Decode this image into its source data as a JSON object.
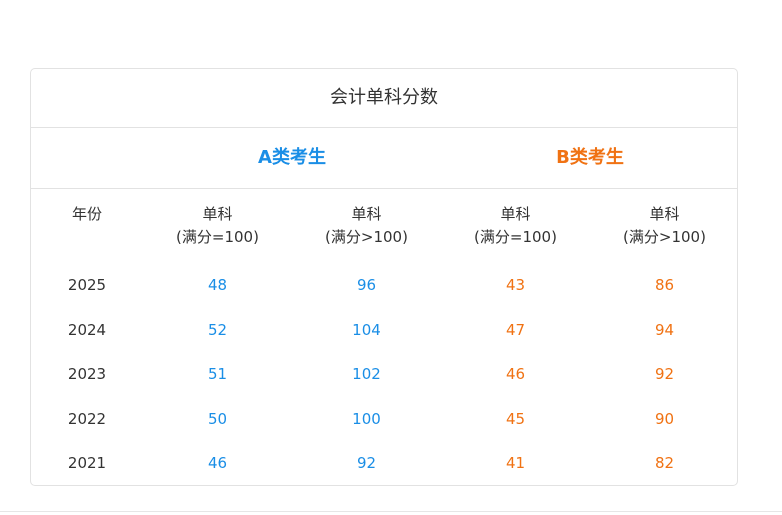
{
  "card": {
    "title": "会计单科分数"
  },
  "groups": {
    "a_label": "A类考生",
    "b_label": "B类考生"
  },
  "columns": {
    "year": "年份",
    "a_full_line1": "单科",
    "a_full_line2": "(满分=100)",
    "a_over_line1": "单科",
    "a_over_line2": "(满分>100)",
    "b_full_line1": "单科",
    "b_full_line2": "(满分=100)",
    "b_over_line1": "单科",
    "b_over_line2": "(满分>100)"
  },
  "rows": [
    {
      "year": "2025",
      "a_full": "48",
      "a_over": "96",
      "b_full": "43",
      "b_over": "86"
    },
    {
      "year": "2024",
      "a_full": "52",
      "a_over": "104",
      "b_full": "47",
      "b_over": "94"
    },
    {
      "year": "2023",
      "a_full": "51",
      "a_over": "102",
      "b_full": "46",
      "b_over": "92"
    },
    {
      "year": "2022",
      "a_full": "50",
      "a_over": "100",
      "b_full": "45",
      "b_over": "90"
    },
    {
      "year": "2021",
      "a_full": "46",
      "a_over": "92",
      "b_full": "41",
      "b_over": "82"
    }
  ],
  "colors": {
    "a_accent": "#1a8ee6",
    "b_accent": "#f07213",
    "text": "#333333",
    "border": "#e2e2e2"
  }
}
